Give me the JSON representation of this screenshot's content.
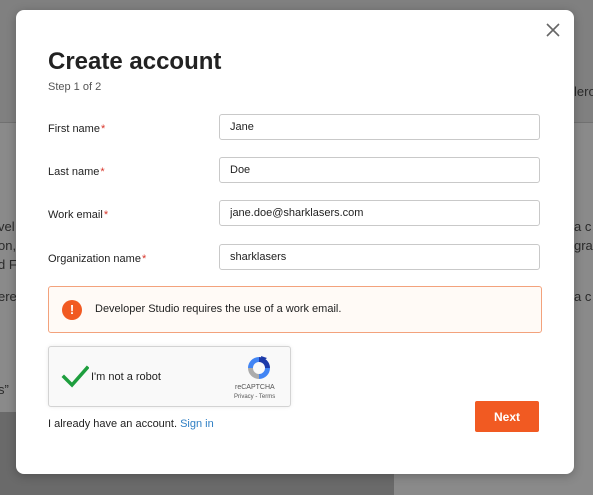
{
  "background": {
    "fragments_right": [
      "lero",
      "a c",
      "grat",
      "a c"
    ],
    "fragments_left": [
      "vel",
      "on,",
      "d F",
      "ere",
      "s”"
    ]
  },
  "modal": {
    "title": "Create account",
    "step": "Step 1 of 2",
    "close_icon": "close-icon",
    "fields": [
      {
        "label": "First name",
        "required": "*",
        "value": "Jane"
      },
      {
        "label": "Last name",
        "required": "*",
        "value": "Doe"
      },
      {
        "label": "Work email",
        "required": "*",
        "value": "jane.doe@sharklasers.com"
      },
      {
        "label": "Organization name",
        "required": "*",
        "value": "sharklasers"
      }
    ],
    "alert": {
      "icon": "info-icon",
      "icon_glyph": "!",
      "text": "Developer Studio requires the use of a work email."
    },
    "captcha": {
      "label": "I'm not a robot",
      "brand": "reCAPTCHA",
      "links": "Privacy - Terms",
      "checked": true
    },
    "signin": {
      "prompt": "I already have an account.",
      "link": "Sign in"
    },
    "next_label": "Next"
  },
  "colors": {
    "accent": "#f15a22",
    "link": "#2f7fc4",
    "required": "#d9362b",
    "check": "#1e9e3e"
  }
}
